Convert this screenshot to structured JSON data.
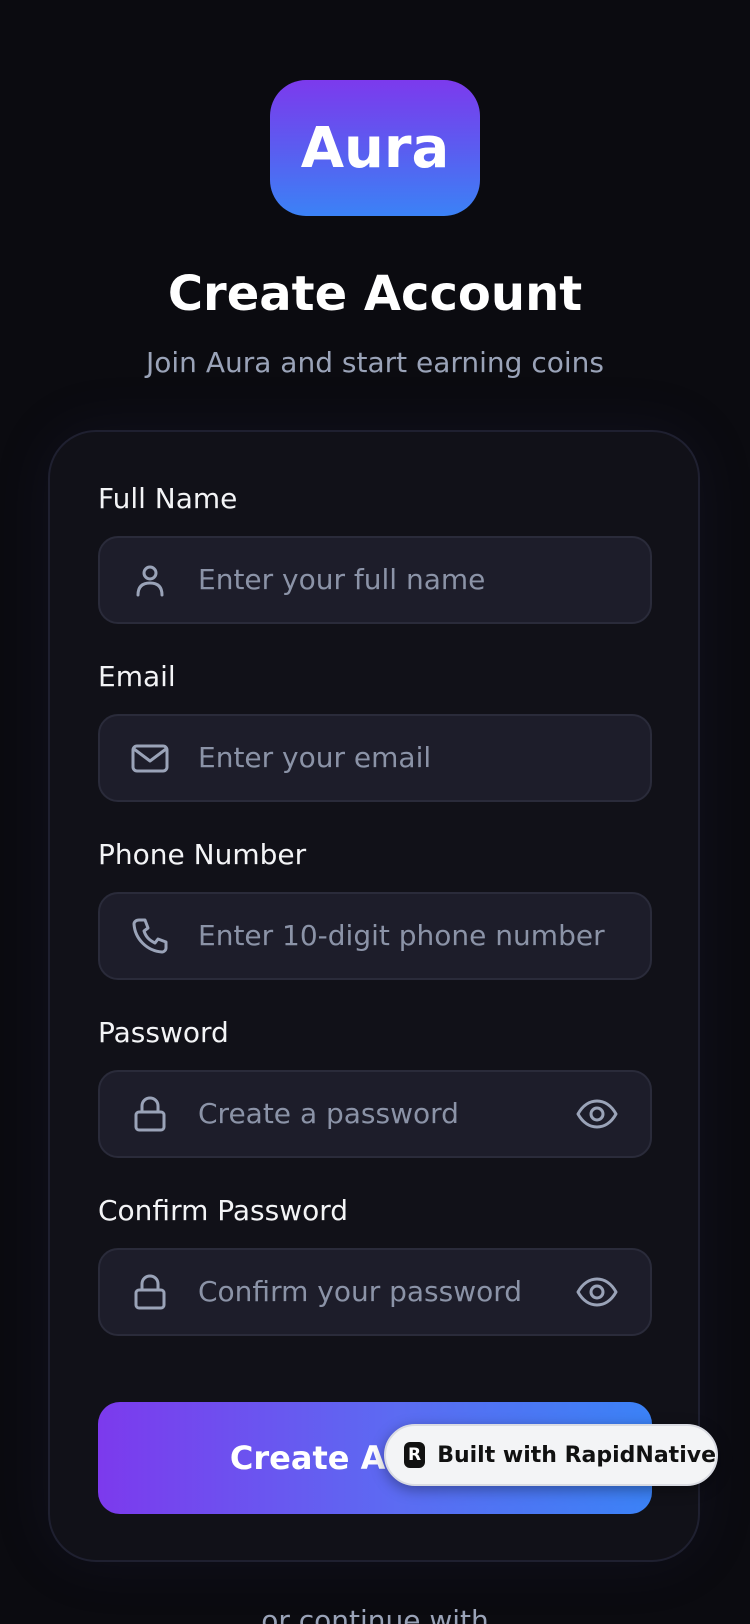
{
  "app": {
    "logo_text": "Aura",
    "title": "Create Account",
    "subtitle": "Join Aura and start earning coins"
  },
  "form": {
    "fields": [
      {
        "label": "Full Name",
        "placeholder": "Enter your full name",
        "icon": "user-icon"
      },
      {
        "label": "Email",
        "placeholder": "Enter your email",
        "icon": "mail-icon"
      },
      {
        "label": "Phone Number",
        "placeholder": "Enter 10-digit phone number",
        "icon": "phone-icon"
      },
      {
        "label": "Password",
        "placeholder": "Create a password",
        "icon": "lock-icon",
        "toggle_icon": "eye-icon"
      },
      {
        "label": "Confirm Password",
        "placeholder": "Confirm your password",
        "icon": "lock-icon",
        "toggle_icon": "eye-icon"
      }
    ],
    "submit_label": "Create Account"
  },
  "badge": {
    "text": "Built with RapidNative",
    "logo_letter": "R"
  },
  "footer": {
    "text": "or continue with"
  },
  "colors": {
    "background": "#0b0b10",
    "card": "#111118",
    "field": "#1d1d2a",
    "accent_start": "#7c3aed",
    "accent_end": "#3b82f6",
    "placeholder": "#8b93a7"
  }
}
